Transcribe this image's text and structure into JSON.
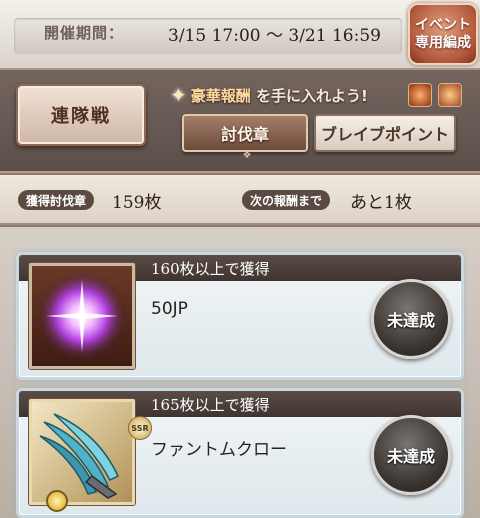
{
  "period": {
    "label": "開催期間：",
    "value": "3/15 17:00 〜 3/21 16:59"
  },
  "event_badge": {
    "line1": "イベント",
    "line2": "専用編成"
  },
  "battle_button": {
    "label": "連隊戦"
  },
  "reward_banner": {
    "text_a": "豪華報酬",
    "text_b": "を手に入れよう!"
  },
  "tabs": [
    {
      "label": "討伐章",
      "active": true
    },
    {
      "label": "ブレイブポイント",
      "active": false
    }
  ],
  "counters": {
    "acquired_label": "獲得討伐章",
    "acquired_value": "159枚",
    "next_label": "次の報酬まで",
    "next_value": "あと1枚"
  },
  "rewards": [
    {
      "threshold": "160枚以上で獲得",
      "item": "50JP",
      "status": "未達成",
      "item_icon": "glowing-orb-icon"
    },
    {
      "threshold": "165枚以上で獲得",
      "item": "ファントムクロー",
      "status": "未達成",
      "item_icon": "claw-weapon-icon",
      "rarity": "SSR"
    }
  ],
  "colors": {
    "accent_brown": "#6d4a3a",
    "card_border": "#c8d8de",
    "status_dark": "#3a3431"
  }
}
